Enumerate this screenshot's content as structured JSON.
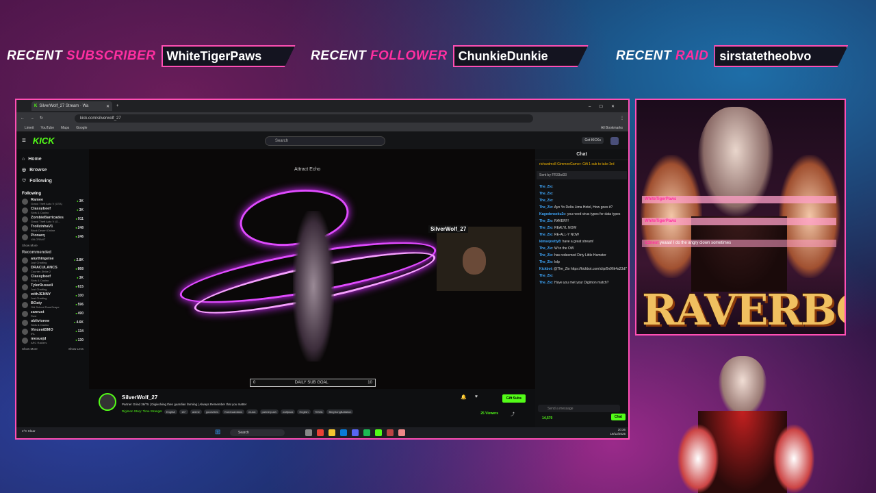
{
  "overlay": {
    "subscriber": {
      "label_a": "RECENT",
      "label_b": "SUBSCRIBER",
      "name": "WhiteTigerPaws"
    },
    "follower": {
      "label_a": "RECENT",
      "label_b": "FOLLOWER",
      "name": "ChunkieDunkie"
    },
    "raid": {
      "label_a": "RECENT",
      "label_b": "RAID",
      "name": "sirstatetheobvo"
    },
    "brand": "RAVERBOYZ",
    "panel_chat": [
      {
        "user": "WhiteTigerPaws",
        "text": ""
      },
      {
        "user": "WhiteTigerPaws",
        "text": ""
      },
      {
        "user": "Iz3nest",
        "text": "yeaaa! I do the angry clown sometimes"
      }
    ],
    "accent_color": "#ff4fb4"
  },
  "browser": {
    "tab_title": "SilverWolf_27 Stream · Wa",
    "url": "kick.com/silverwolf_27",
    "bookmarks": [
      "Limeit",
      "YouTube",
      "Maps",
      "Google"
    ],
    "all_bookmarks": "All Bookmarks"
  },
  "kick": {
    "logo": "KICK",
    "search_placeholder": "Search",
    "get_kicks": "Get KICKs",
    "nav": [
      "Home",
      "Browse",
      "Following"
    ],
    "following_header": "Following",
    "following": [
      {
        "name": "Ramee",
        "sub": "Grand Theft Auto V (GTA)",
        "viewers": "3K"
      },
      {
        "name": "Classybeef",
        "sub": "Slots & Casino",
        "viewers": "3K"
      },
      {
        "name": "ZombieBarricades",
        "sub": "Grand Theft Auto V (G...",
        "viewers": "911"
      },
      {
        "name": "TrollzinhaV1",
        "sub": "Black Desert Online",
        "viewers": "248"
      },
      {
        "name": "Pionarq",
        "sub": "VALORANT",
        "viewers": "246"
      }
    ],
    "show_more": "Show More",
    "recommended_header": "Recommended",
    "recommended": [
      {
        "name": "anythingelse",
        "sub": "Just Chatting",
        "viewers": "2.8K"
      },
      {
        "name": "DRACULANCS",
        "sub": "Counter-Strike 2",
        "viewers": "868"
      },
      {
        "name": "Classybeef",
        "sub": "Slots & Casino",
        "viewers": "3K"
      },
      {
        "name": "TylerRussell",
        "sub": "Just Chatting",
        "viewers": "615"
      },
      {
        "name": "withJENNY",
        "sub": "Just Chatting",
        "viewers": "100"
      },
      {
        "name": "BOaty",
        "sub": "Old School RuneScape",
        "viewers": "596"
      },
      {
        "name": "zanrust",
        "sub": "Rust",
        "viewers": "490"
      },
      {
        "name": "obliviorew",
        "sub": "Slots & Casino",
        "viewers": "4.6K"
      },
      {
        "name": "VincentBMO",
        "sub": "IRL",
        "viewers": "134"
      },
      {
        "name": "mesuejd",
        "sub": "ARC Raiders",
        "viewers": "130"
      }
    ],
    "show_more_2": "Show More",
    "show_less": "Show Less",
    "player": {
      "title": "Attract Echo",
      "cam_name": "SilverWolf_27",
      "goal_label": "DAILY SUB GOAL",
      "goal_current": "0",
      "goal_target": "10"
    },
    "stream": {
      "streamer": "SilverWolf_27",
      "title": "Partner Grind 38/75 | Digivolving then guardian farming | Always Remember that you matter",
      "category": "Digimon Story: Time Stranger",
      "tags": [
        "English",
        "18+",
        "anime",
        "goodvibes",
        "KickGuardians",
        "music",
        "partnerpush",
        "wolfpack",
        "English",
        "YNWA",
        "BingSongBattalion"
      ],
      "gift_label": "Gift Subs",
      "viewers": "25 Viewers"
    },
    "chat": {
      "header": "Chat",
      "pinned": "richardmc8  GimmenGamer: Gift 1 sub to take 3rd",
      "sent_by": "Sent by  FR33st33",
      "messages": [
        {
          "user": "The_Zio",
          "text": ""
        },
        {
          "user": "The_Zio",
          "text": ""
        },
        {
          "user": "The_Zio",
          "text": ""
        },
        {
          "user": "The_Zio",
          "text": "Ayo Yo Delta Lima Hotel, How goes it?"
        },
        {
          "user": "Kagedenseku2c",
          "text": "you need virus types for data types"
        },
        {
          "user": "The_Zio",
          "text": "RAVER!!!"
        },
        {
          "user": "The_Zio",
          "text": "REALYL NOW"
        },
        {
          "user": "The_Zio",
          "text": "RE-ALL-Y NOW"
        },
        {
          "user": "kimsepretty8",
          "text": "have a great stream!"
        },
        {
          "user": "The_Zio",
          "text": "W to the OW"
        },
        {
          "user": "The_Zio",
          "text": "has redeemed Dirty Little Hamster"
        },
        {
          "user": "The_Zio",
          "text": "lolp"
        },
        {
          "user": "Kickbot",
          "text": "@The_Zio https://kickbot.com/clip/0n96k4a23d7"
        },
        {
          "user": "The_Zio",
          "text": ""
        },
        {
          "user": "The_Zio",
          "text": "Have you met your Digimon match?"
        }
      ],
      "kicks_balance": "14,570",
      "input_placeholder": "Send a message",
      "chat_button": "Chat"
    }
  },
  "taskbar": {
    "search": "Search",
    "time": "20:36",
    "date": "19/12/2025",
    "weather": "4°C Clear"
  }
}
